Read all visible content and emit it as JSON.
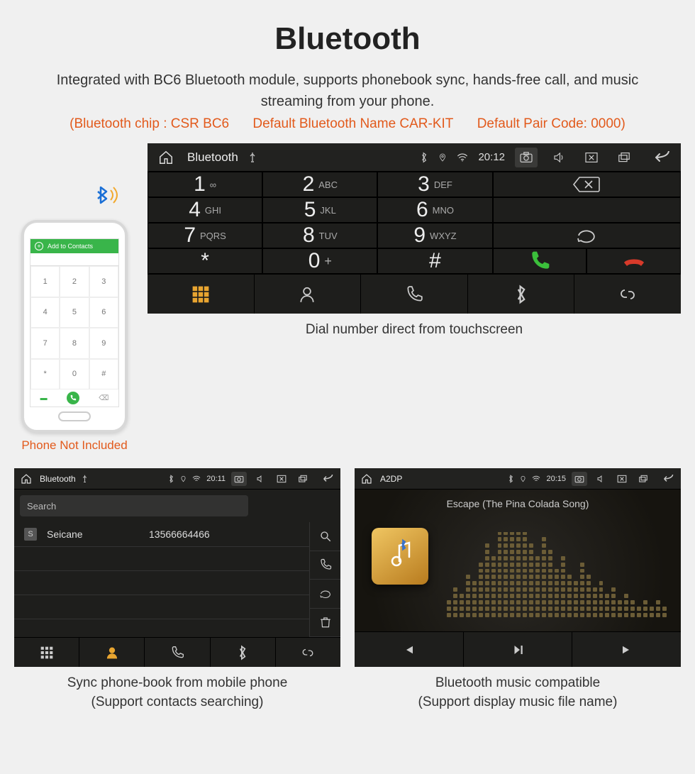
{
  "header": {
    "title": "Bluetooth",
    "subtitle": "Integrated with BC6 Bluetooth module, supports phonebook sync, hands-free call, and music streaming from your phone.",
    "spec_chip": "(Bluetooth chip : CSR BC6",
    "spec_name": "Default Bluetooth Name CAR-KIT",
    "spec_code": "Default Pair Code: 0000)"
  },
  "phone_mock": {
    "add_contacts": "Add to Contacts",
    "keys": [
      "1",
      "2",
      "3",
      "4",
      "5",
      "6",
      "7",
      "8",
      "9",
      "*",
      "0",
      "#"
    ],
    "caption": "Phone Not Included"
  },
  "dialer_screen": {
    "status": {
      "title": "Bluetooth",
      "time": "20:12"
    },
    "keys": [
      {
        "num": "1",
        "sub": "∞"
      },
      {
        "num": "2",
        "sub": "ABC"
      },
      {
        "num": "3",
        "sub": "DEF"
      },
      {
        "num": "4",
        "sub": "GHI"
      },
      {
        "num": "5",
        "sub": "JKL"
      },
      {
        "num": "6",
        "sub": "MNO"
      },
      {
        "num": "7",
        "sub": "PQRS"
      },
      {
        "num": "8",
        "sub": "TUV"
      },
      {
        "num": "9",
        "sub": "WXYZ"
      },
      {
        "num": "*",
        "sub": ""
      },
      {
        "num": "0",
        "sub": "+"
      },
      {
        "num": "#",
        "sub": ""
      }
    ],
    "caption": "Dial number direct from touchscreen"
  },
  "contacts_screen": {
    "status": {
      "title": "Bluetooth",
      "time": "20:11"
    },
    "search_placeholder": "Search",
    "contacts": [
      {
        "initial": "S",
        "name": "Seicane",
        "number": "13566664466"
      }
    ],
    "caption_line1": "Sync phone-book from mobile phone",
    "caption_line2": "(Support contacts searching)"
  },
  "music_screen": {
    "status": {
      "title": "A2DP",
      "time": "20:15"
    },
    "track": "Escape (The Pina Colada Song)",
    "caption_line1": "Bluetooth music compatible",
    "caption_line2": "(Support display music file name)"
  },
  "colors": {
    "accent_orange": "#e25a1c",
    "accent_gold": "#e8a530",
    "call_green": "#3bbf3b",
    "hangup_red": "#d83a2a"
  }
}
